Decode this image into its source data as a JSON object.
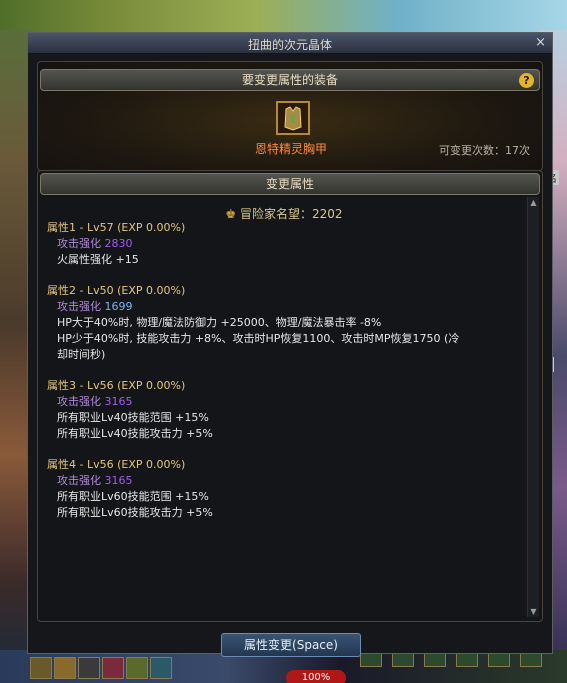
{
  "window": {
    "title": "扭曲的次元晶体",
    "close_glyph": "×"
  },
  "top_section": {
    "header": "要变更属性的装备",
    "help_glyph": "?",
    "equipment_name": "恩特精灵胸甲",
    "change_count": "可变更次数：17次"
  },
  "change_section": {
    "header": "变更属性",
    "fame": "冒险家名望：2202"
  },
  "attributes": [
    {
      "title": "属性1 - Lv57 (EXP 0.00%)",
      "atk_label": "攻击强化",
      "atk_value": "2830",
      "atk_color": "purple",
      "lines": [
        "火属性强化 +15"
      ]
    },
    {
      "title": "属性2 - Lv50 (EXP 0.00%)",
      "atk_label": "攻击强化",
      "atk_value": "1699",
      "atk_color": "blue",
      "lines": [
        "HP大于40%时, 物理/魔法防御力 +25000、物理/魔法暴击率 -8%",
        "HP少于40%时, 技能攻击力 +8%、攻击时HP恢复1100、攻击时MP恢复1750 (冷",
        "却时间秒)"
      ]
    },
    {
      "title": "属性3 - Lv56 (EXP 0.00%)",
      "atk_label": "攻击强化",
      "atk_value": "3165",
      "atk_color": "purple",
      "lines": [
        "所有职业Lv40技能范围 +15%",
        "所有职业Lv40技能攻击力 +5%"
      ]
    },
    {
      "title": "属性4 - Lv56 (EXP 0.00%)",
      "atk_label": "攻击强化",
      "atk_value": "3165",
      "atk_color": "purple",
      "lines": [
        "所有职业Lv60技能范围 +15%",
        "所有职业Lv60技能攻击力 +5%"
      ]
    }
  ],
  "apply_button": "属性变更(Space)",
  "hud": {
    "hp_percent": "100%"
  }
}
